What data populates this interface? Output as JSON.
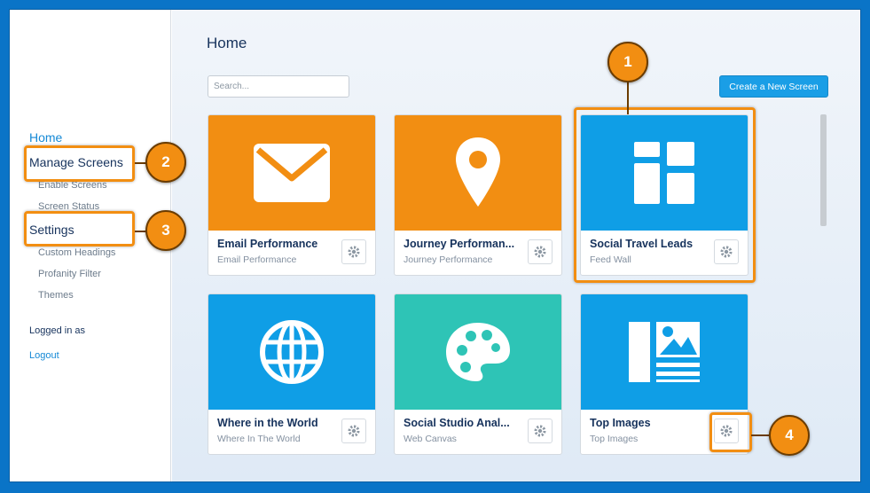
{
  "sidebar": {
    "home": "Home",
    "manage_screens": "Manage Screens",
    "enable_screens": "Enable Screens",
    "screen_status": "Screen Status",
    "settings": "Settings",
    "custom_headings": "Custom Headings",
    "profanity_filter": "Profanity Filter",
    "themes": "Themes",
    "logged_in_as": "Logged in as",
    "logout": "Logout"
  },
  "main": {
    "title": "Home",
    "search_placeholder": "Search...",
    "create_button": "Create a New Screen"
  },
  "cards": [
    {
      "title": "Email Performance",
      "subtitle": "Email Performance",
      "icon": "envelope-icon",
      "color": "#f28e12"
    },
    {
      "title": "Journey Performan...",
      "subtitle": "Journey Performance",
      "icon": "map-pin-icon",
      "color": "#f28e12"
    },
    {
      "title": "Social Travel Leads",
      "subtitle": "Feed Wall",
      "icon": "dashboard-tiles-icon",
      "color": "#0f9ee6"
    },
    {
      "title": "Where in the World",
      "subtitle": "Where In The World",
      "icon": "globe-icon",
      "color": "#0f9ee6"
    },
    {
      "title": "Social Studio Anal...",
      "subtitle": "Web Canvas",
      "icon": "palette-icon",
      "color": "#2ec4b6"
    },
    {
      "title": "Top Images",
      "subtitle": "Top Images",
      "icon": "image-gallery-icon",
      "color": "#0f9ee6"
    }
  ],
  "callouts": [
    "1",
    "2",
    "3",
    "4"
  ],
  "colors": {
    "accent": "#f28e12",
    "link": "#1589d6",
    "frame": "#0a74c7"
  }
}
